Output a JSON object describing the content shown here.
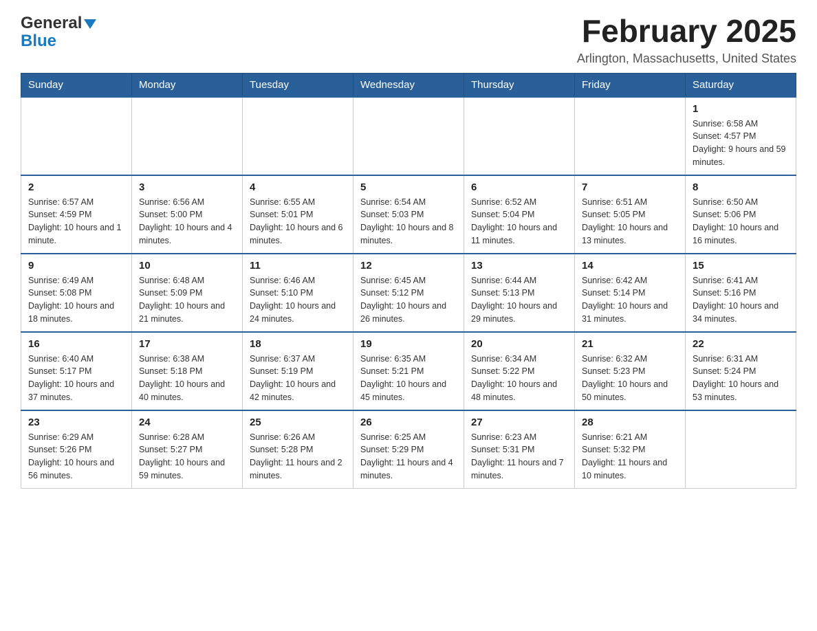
{
  "header": {
    "logo_general": "General",
    "logo_blue": "Blue",
    "title": "February 2025",
    "subtitle": "Arlington, Massachusetts, United States"
  },
  "days_of_week": [
    "Sunday",
    "Monday",
    "Tuesday",
    "Wednesday",
    "Thursday",
    "Friday",
    "Saturday"
  ],
  "weeks": [
    [
      {
        "day": "",
        "info": ""
      },
      {
        "day": "",
        "info": ""
      },
      {
        "day": "",
        "info": ""
      },
      {
        "day": "",
        "info": ""
      },
      {
        "day": "",
        "info": ""
      },
      {
        "day": "",
        "info": ""
      },
      {
        "day": "1",
        "info": "Sunrise: 6:58 AM\nSunset: 4:57 PM\nDaylight: 9 hours and 59 minutes."
      }
    ],
    [
      {
        "day": "2",
        "info": "Sunrise: 6:57 AM\nSunset: 4:59 PM\nDaylight: 10 hours and 1 minute."
      },
      {
        "day": "3",
        "info": "Sunrise: 6:56 AM\nSunset: 5:00 PM\nDaylight: 10 hours and 4 minutes."
      },
      {
        "day": "4",
        "info": "Sunrise: 6:55 AM\nSunset: 5:01 PM\nDaylight: 10 hours and 6 minutes."
      },
      {
        "day": "5",
        "info": "Sunrise: 6:54 AM\nSunset: 5:03 PM\nDaylight: 10 hours and 8 minutes."
      },
      {
        "day": "6",
        "info": "Sunrise: 6:52 AM\nSunset: 5:04 PM\nDaylight: 10 hours and 11 minutes."
      },
      {
        "day": "7",
        "info": "Sunrise: 6:51 AM\nSunset: 5:05 PM\nDaylight: 10 hours and 13 minutes."
      },
      {
        "day": "8",
        "info": "Sunrise: 6:50 AM\nSunset: 5:06 PM\nDaylight: 10 hours and 16 minutes."
      }
    ],
    [
      {
        "day": "9",
        "info": "Sunrise: 6:49 AM\nSunset: 5:08 PM\nDaylight: 10 hours and 18 minutes."
      },
      {
        "day": "10",
        "info": "Sunrise: 6:48 AM\nSunset: 5:09 PM\nDaylight: 10 hours and 21 minutes."
      },
      {
        "day": "11",
        "info": "Sunrise: 6:46 AM\nSunset: 5:10 PM\nDaylight: 10 hours and 24 minutes."
      },
      {
        "day": "12",
        "info": "Sunrise: 6:45 AM\nSunset: 5:12 PM\nDaylight: 10 hours and 26 minutes."
      },
      {
        "day": "13",
        "info": "Sunrise: 6:44 AM\nSunset: 5:13 PM\nDaylight: 10 hours and 29 minutes."
      },
      {
        "day": "14",
        "info": "Sunrise: 6:42 AM\nSunset: 5:14 PM\nDaylight: 10 hours and 31 minutes."
      },
      {
        "day": "15",
        "info": "Sunrise: 6:41 AM\nSunset: 5:16 PM\nDaylight: 10 hours and 34 minutes."
      }
    ],
    [
      {
        "day": "16",
        "info": "Sunrise: 6:40 AM\nSunset: 5:17 PM\nDaylight: 10 hours and 37 minutes."
      },
      {
        "day": "17",
        "info": "Sunrise: 6:38 AM\nSunset: 5:18 PM\nDaylight: 10 hours and 40 minutes."
      },
      {
        "day": "18",
        "info": "Sunrise: 6:37 AM\nSunset: 5:19 PM\nDaylight: 10 hours and 42 minutes."
      },
      {
        "day": "19",
        "info": "Sunrise: 6:35 AM\nSunset: 5:21 PM\nDaylight: 10 hours and 45 minutes."
      },
      {
        "day": "20",
        "info": "Sunrise: 6:34 AM\nSunset: 5:22 PM\nDaylight: 10 hours and 48 minutes."
      },
      {
        "day": "21",
        "info": "Sunrise: 6:32 AM\nSunset: 5:23 PM\nDaylight: 10 hours and 50 minutes."
      },
      {
        "day": "22",
        "info": "Sunrise: 6:31 AM\nSunset: 5:24 PM\nDaylight: 10 hours and 53 minutes."
      }
    ],
    [
      {
        "day": "23",
        "info": "Sunrise: 6:29 AM\nSunset: 5:26 PM\nDaylight: 10 hours and 56 minutes."
      },
      {
        "day": "24",
        "info": "Sunrise: 6:28 AM\nSunset: 5:27 PM\nDaylight: 10 hours and 59 minutes."
      },
      {
        "day": "25",
        "info": "Sunrise: 6:26 AM\nSunset: 5:28 PM\nDaylight: 11 hours and 2 minutes."
      },
      {
        "day": "26",
        "info": "Sunrise: 6:25 AM\nSunset: 5:29 PM\nDaylight: 11 hours and 4 minutes."
      },
      {
        "day": "27",
        "info": "Sunrise: 6:23 AM\nSunset: 5:31 PM\nDaylight: 11 hours and 7 minutes."
      },
      {
        "day": "28",
        "info": "Sunrise: 6:21 AM\nSunset: 5:32 PM\nDaylight: 11 hours and 10 minutes."
      },
      {
        "day": "",
        "info": ""
      }
    ]
  ]
}
